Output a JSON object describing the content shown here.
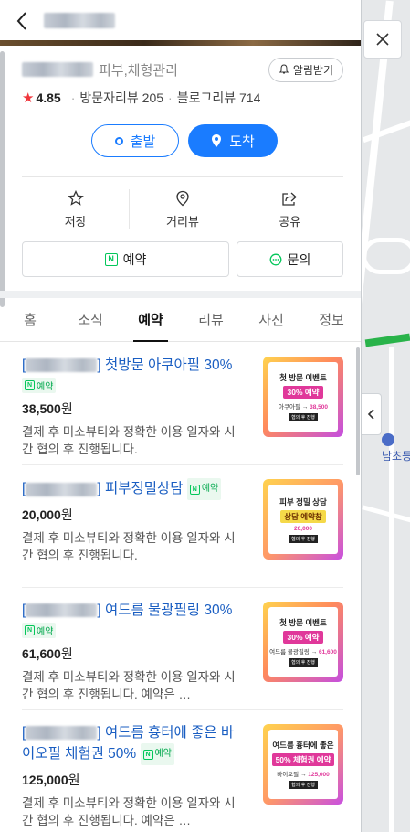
{
  "header": {
    "title": ""
  },
  "place": {
    "category": "피부,체형관리",
    "alarm_label": "알림받기",
    "rating": "4.85",
    "visitor_reviews": "방문자리뷰 205",
    "blog_reviews": "블로그리뷰 714"
  },
  "route": {
    "depart_label": "출발",
    "arrive_label": "도착"
  },
  "actions": {
    "save": "저장",
    "distance": "거리뷰",
    "share": "공유"
  },
  "cta": {
    "book": "예약",
    "ask": "문의"
  },
  "tabs": [
    "홈",
    "소식",
    "예약",
    "리뷰",
    "사진",
    "정보"
  ],
  "active_tab": "예약",
  "items": [
    {
      "title": "첫방문 아쿠아필 30%",
      "badge": "예약",
      "price": "38,500",
      "unit": "원",
      "desc": "결제 후 미소뷰티와 정확한 이용 일자와 시간 협의 후 진행됩니다.",
      "thumb": {
        "line1": "첫 방문 이벤트",
        "line2": "30% 예약",
        "line3a": "아쿠아필",
        "line3b": "38,500",
        "line4": "협의 후 진행"
      }
    },
    {
      "title": "피부정밀상담",
      "badge": "예약",
      "price": "20,000",
      "unit": "원",
      "desc": "결제 후 미소뷰티와 정확한 이용 일자와 시간 협의 후 진행됩니다.",
      "thumb": {
        "line1": "피부 정밀 상담",
        "line2": "상담 예약창",
        "line3a": "",
        "line3b": "20,000",
        "line4": "협의 후 진행"
      }
    },
    {
      "title": "여드름 물광필링 30%",
      "badge": "예약",
      "price": "61,600",
      "unit": "원",
      "desc": "결제 후 미소뷰티와 정확한 이용 일자와 시간 협의 후 진행됩니다. 예약은 …",
      "thumb": {
        "line1": "첫 방문 이벤트",
        "line2": "30% 예약",
        "line3a": "여드름 물광필링",
        "line3b": "61,600",
        "line4": "협의 후 진행"
      }
    },
    {
      "title": "여드름 흉터에 좋은 바이오필 체험권 50%",
      "badge": "예약",
      "price": "125,000",
      "unit": "원",
      "desc": "결제 후 미소뷰티와 정확한 이용 일자와 시간 협의 후 진행됩니다. 예약은 …",
      "thumb": {
        "line1": "여드름 흉터에 좋은",
        "line2": "50% 체험권 예약",
        "line3a": "바이오필",
        "line3b": "125,000",
        "line4": "협의 후 진행"
      }
    }
  ],
  "map": {
    "label": "남초등학교",
    "nbadge_letter": "N"
  }
}
